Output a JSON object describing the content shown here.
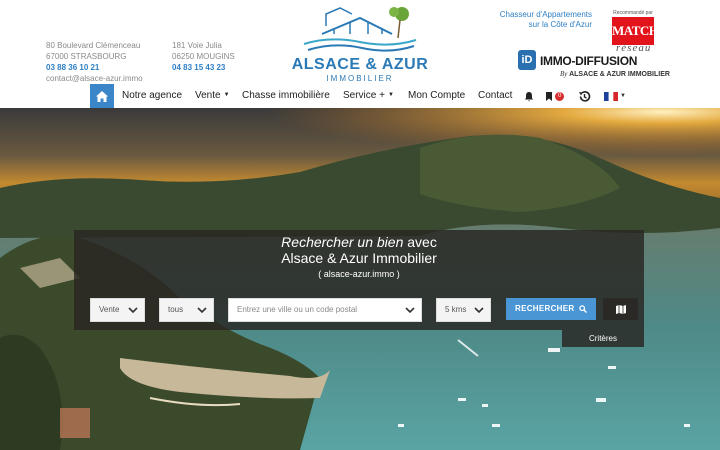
{
  "header": {
    "address1": {
      "line1": "80 Boulevard Clémenceau",
      "line2": "67000 STRASBOURG",
      "phone": "03 88 36 10 21",
      "email": "contact@alsace-azur.immo"
    },
    "address2": {
      "line1": "181 Voie Julia",
      "line2": "06250 MOUGINS",
      "phone": "04 83 15 43 23"
    },
    "logo": {
      "name": "ALSACE & AZUR",
      "sub": "IMMOBILIER"
    },
    "chasseur": {
      "line1": "Chasseur d'Appartements",
      "line2": "sur la Côte d'Azur"
    },
    "match": {
      "recommended": "Recommandé par",
      "name": "MATCH"
    },
    "reseau": "réseau",
    "immo_diffusion": {
      "mark": "iD",
      "title": "IMMO-DIFFUSION",
      "by": "By",
      "by_company": "ALSACE & AZUR IMMOBILIER"
    }
  },
  "nav": {
    "items": [
      {
        "label": "Notre agence"
      },
      {
        "label": "Vente"
      },
      {
        "label": "Chasse immobilière"
      },
      {
        "label": "Service +"
      },
      {
        "label": "Mon Compte"
      },
      {
        "label": "Contact"
      }
    ],
    "favorites_count": "0",
    "icons": [
      "home-icon",
      "bell-icon",
      "bookmark-icon",
      "history-icon",
      "flag-fr-icon"
    ]
  },
  "search": {
    "title_italic": "Rechercher un bien",
    "title_rest": " avec",
    "title_line2": "Alsace & Azur Immobilier",
    "title_line3": "( alsace-azur.immo )",
    "transaction": "Vente",
    "type": "tous",
    "location_placeholder": "Entrez une ville ou un code postal",
    "radius": "5 kms",
    "search_label": "RECHERCHER",
    "criteria_label": "Critères"
  },
  "colors": {
    "accent": "#3a86c8",
    "search_button": "#4a96d4",
    "badge": "#d62e2e",
    "match_red": "#e2131a"
  }
}
